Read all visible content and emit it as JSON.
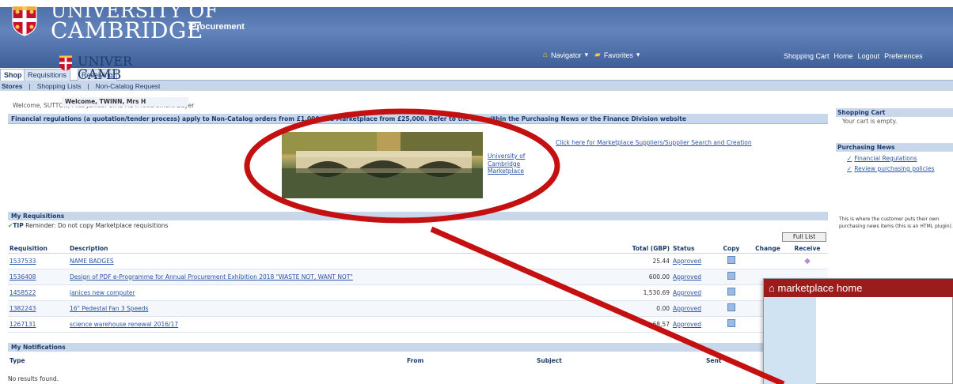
{
  "header": {
    "university_line1": "UNIVERSITY OF",
    "university_line2": "CAMBRIDGE",
    "product": "iProcurement",
    "nav_navigator": "Navigator",
    "nav_favorites": "Favorites",
    "links": [
      "Shopping Cart",
      "Home",
      "Logout",
      "Preferences"
    ]
  },
  "tabs": [
    {
      "label": "Shop",
      "active": true
    },
    {
      "label": "Requisitions",
      "active": false
    },
    {
      "label": "Receiving",
      "active": false
    }
  ],
  "subnav": [
    "Stores",
    "Shopping Lists",
    "Non-Catalog Request"
  ],
  "welcome": "Welcome, SUTTON, Miss Janice! U.F.S AG iProcurement Buyer",
  "financial_notice": "Financial regulations (a quotation/tender process) apply to Non-Catalog orders from £1,000 and Marketplace from £25,000. Refer to the link within the Purchasing News or the Finance Division website",
  "marketplace_link": "University of Cambridge Marketplace",
  "supplier_link": "Click here for Marketplace Suppliers/Supplier Search and Creation",
  "my_requisitions": {
    "title": "My Requisitions",
    "tip_label": "TIP",
    "tip_text": "Reminder: Do not copy Marketplace requisitions",
    "full_list_label": "Full List",
    "columns": [
      "Requisition",
      "Description",
      "Total (GBP)",
      "Status",
      "Copy",
      "Change",
      "Receive"
    ],
    "rows": [
      {
        "requisition": "1537533",
        "description": "NAME BADGES",
        "total": "25.44",
        "status": "Approved",
        "receive": true,
        "change": false
      },
      {
        "requisition": "1536408",
        "description": "Design of PDF e-Programme for Annual Procurement Exhibition 2018 \"WASTE NOT, WANT NOT\"",
        "total": "600.00",
        "status": "Approved",
        "receive": false,
        "change": false
      },
      {
        "requisition": "1458522",
        "description": "janices new computer",
        "total": "1,530.69",
        "status": "Approved",
        "receive": false,
        "change": true
      },
      {
        "requisition": "1382243",
        "description": "16\" Pedestal Fan 3 Speeds",
        "total": "0.00",
        "status": "Approved",
        "receive": false,
        "change": false
      },
      {
        "requisition": "1267131",
        "description": "science warehouse renewal 2016/17",
        "total": "68,57",
        "status": "Approved",
        "receive": false,
        "change": false
      }
    ]
  },
  "my_notifications": {
    "title": "My Notifications",
    "columns": [
      "Type",
      "From",
      "Subject",
      "Sent"
    ],
    "empty_text": "No results found."
  },
  "sidebar": {
    "shopping_cart_title": "Shopping Cart",
    "cart_empty": "Your cart is empty.",
    "purchasing_news_title": "Purchasing News",
    "news_links": [
      "Financial Regulations",
      "Review purchasing policies"
    ],
    "note": "This is where the customer puts their own purchasing news items (this is an HTML plugin)."
  },
  "inset": {
    "bar_label": "marketplace home",
    "university_line1": "UNIVER",
    "university_line2": "CAMB",
    "welcome": "Welcome, TWINN, Mrs H"
  },
  "colors": {
    "header_blue": "#4a6aa4",
    "section_blue": "#c9d7eb",
    "link_blue": "#2b55a6",
    "annotation_red": "#c41010",
    "marketplace_red": "#9b1c1c"
  }
}
